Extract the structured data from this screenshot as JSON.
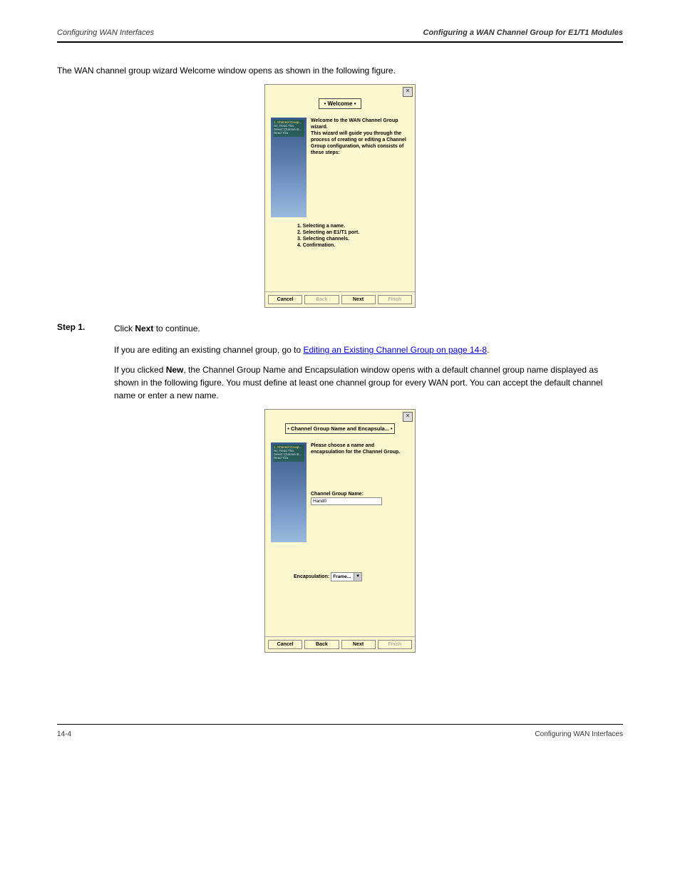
{
  "header": {
    "left": "Configuring WAN Interfaces",
    "right": "Configuring a WAN Channel Group for E1/T1 Modules"
  },
  "para1": "The WAN channel group wizard Welcome window opens as shown in the following figure.",
  "dialog1": {
    "title": "Welcome",
    "sidebar": [
      "1. Channel Group...",
      "Ns.    Read This",
      "Select Channel at...",
      "Read This",
      ""
    ],
    "intro1": "Welcome to the WAN Channel Group wizard.",
    "intro2": "This wizard will guide you through the process of creating or editing a Channel Group configuration, which consists of these steps:",
    "steps": [
      "1. Selecting a name.",
      "2. Selecting an E1/T1 port.",
      "3. Selecting channels.",
      "4. Confirmation."
    ],
    "buttons": {
      "cancel": "Cancel",
      "back": "Back",
      "next": "Next",
      "finish": "Finish"
    }
  },
  "step1": {
    "label": "Step 1.",
    "text_prefix": "Click ",
    "text_bold": "Next",
    "text_suffix": " to continue."
  },
  "link_text": "Editing an Existing Channel Group on page 14-8",
  "para2_prefix": "If you are editing an existing channel group, go to ",
  "para2_suffix": ".",
  "para3_prefix": "If you clicked ",
  "para3_bold": "New",
  "para3_suffix": ", the Channel Group Name and Encapsulation window opens with a default channel group name displayed as shown in the following figure. You must define at least one channel group for every WAN port. You can accept the default channel name or enter a new name.",
  "dialog2": {
    "title": "Channel Group Name and Encapsula...",
    "sidebar": [
      "1. Channel Group...",
      "Ns.    Read This",
      "Select Channel at...",
      "Read This"
    ],
    "intro": "Please choose a name and encapsulation for the Channel Group.",
    "field_label": "Channel Group Name:",
    "field_value": "Hand0",
    "encap_label": "Encapsulation:",
    "encap_value": "Frame...",
    "buttons": {
      "cancel": "Cancel",
      "back": "Back",
      "next": "Next",
      "finish": "Finish"
    }
  },
  "footer": {
    "left": "14-4",
    "right": "Configuring WAN Interfaces"
  }
}
